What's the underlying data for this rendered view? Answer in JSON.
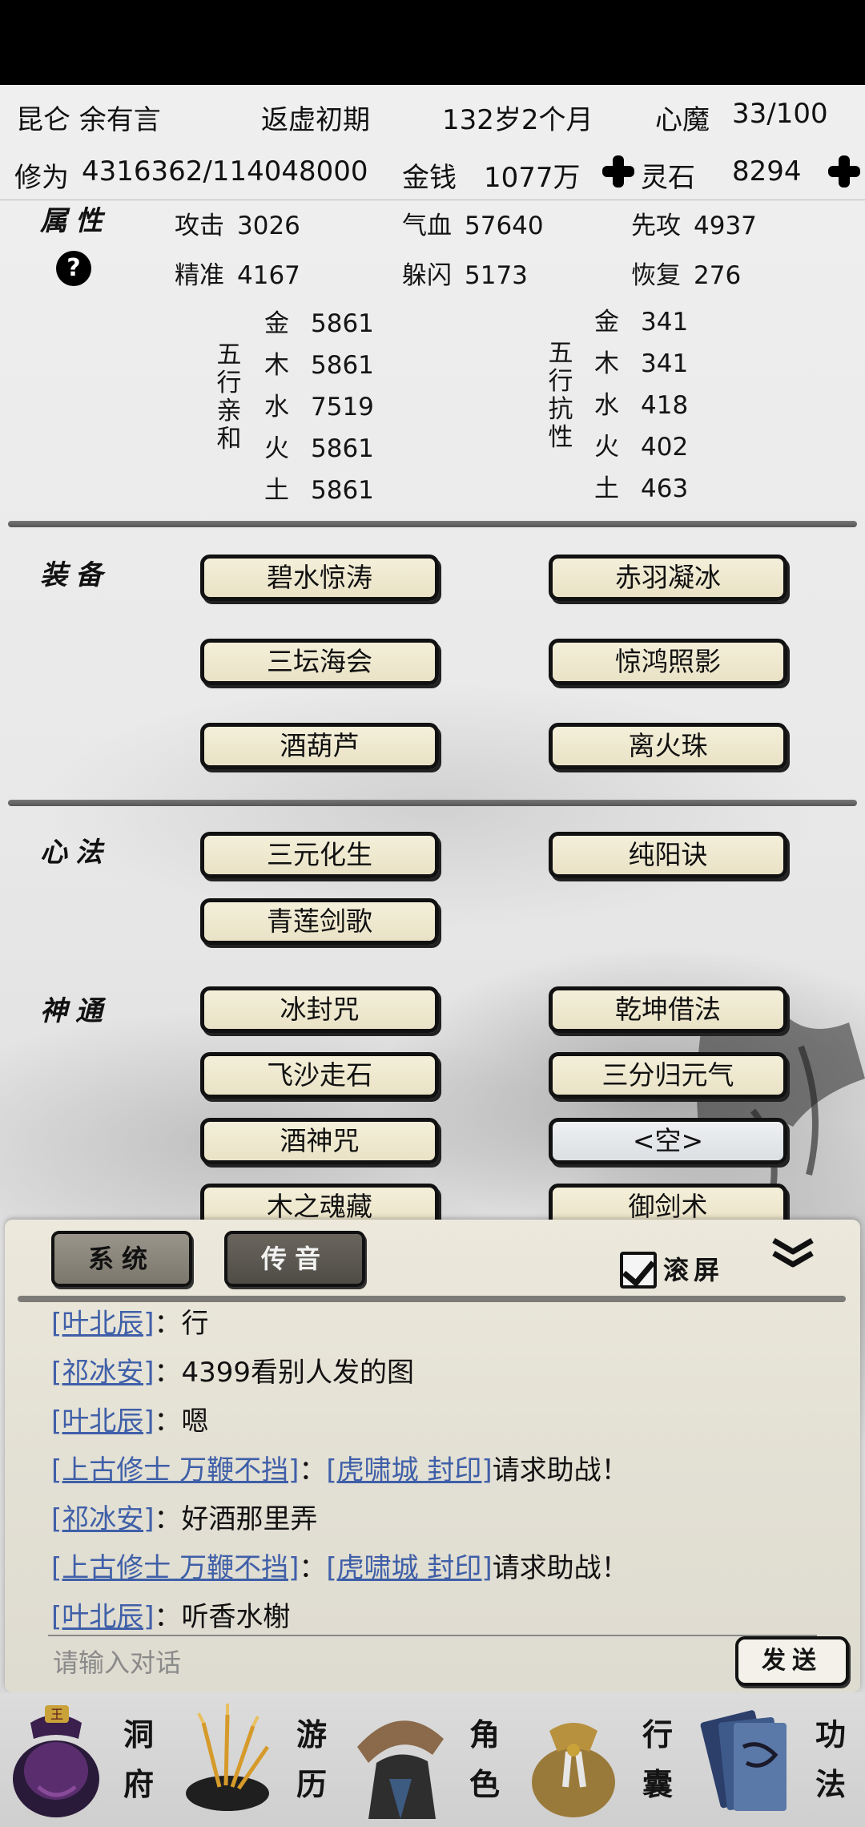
{
  "header": {
    "sect_name": "昆仑 余有言",
    "realm": "返虚初期",
    "age": "132岁2个月",
    "heart_demon_label": "心魔",
    "heart_demon_value": "33/100",
    "cultivation_label": "修为",
    "cultivation_value": "4316362/114048000",
    "money_label": "金钱",
    "money_value": "1077万",
    "spirit_stone_label": "灵石",
    "spirit_stone_value": "8294"
  },
  "attributes": {
    "title": "属性",
    "help": "?",
    "attack_label": "攻击",
    "attack_value": "3026",
    "hp_label": "气血",
    "hp_value": "57640",
    "initiative_label": "先攻",
    "initiative_value": "4937",
    "accuracy_label": "精准",
    "accuracy_value": "4167",
    "dodge_label": "躲闪",
    "dodge_value": "5173",
    "recovery_label": "恢复",
    "recovery_value": "276",
    "affinity_title": [
      "五",
      "行",
      "亲",
      "和"
    ],
    "resist_title": [
      "五",
      "行",
      "抗",
      "性"
    ],
    "affinity": [
      {
        "label": "金",
        "value": "5861"
      },
      {
        "label": "木",
        "value": "5861"
      },
      {
        "label": "水",
        "value": "7519"
      },
      {
        "label": "火",
        "value": "5861"
      },
      {
        "label": "土",
        "value": "5861"
      }
    ],
    "resistance": [
      {
        "label": "金",
        "value": "341"
      },
      {
        "label": "木",
        "value": "341"
      },
      {
        "label": "水",
        "value": "418"
      },
      {
        "label": "火",
        "value": "402"
      },
      {
        "label": "土",
        "value": "463"
      }
    ]
  },
  "equipment": {
    "title": "装备",
    "items": [
      "碧水惊涛",
      "赤羽凝冰",
      "三坛海会",
      "惊鸿照影",
      "酒葫芦",
      "离火珠"
    ]
  },
  "mental_methods": {
    "title": "心法",
    "items": [
      "三元化生",
      "纯阳诀",
      "青莲剑歌"
    ]
  },
  "divine_arts": {
    "title": "神通",
    "items": [
      "冰封咒",
      "乾坤借法",
      "飞沙走石",
      "三分归元气",
      "酒神咒",
      "<空>",
      "木之魂藏",
      "御剑术"
    ]
  },
  "chat": {
    "tab_system": "系统",
    "tab_whisper": "传音",
    "scroll_label": "滚屏",
    "messages": [
      {
        "name": "[叶北辰]",
        "sep": "：",
        "link2": "",
        "text": "行"
      },
      {
        "name": "[祁冰安]",
        "sep": "：",
        "link2": "",
        "text": "4399看别人发的图"
      },
      {
        "name": "[叶北辰]",
        "sep": "：",
        "link2": "",
        "text": "嗯"
      },
      {
        "name": "[上古修士 万鞭不挡]",
        "sep": "：",
        "link2": "[虎啸城 封印]",
        "text": "请求助战！"
      },
      {
        "name": "[祁冰安]",
        "sep": "：",
        "link2": "",
        "text": "好酒那里弄"
      },
      {
        "name": "[上古修士 万鞭不挡]",
        "sep": "：",
        "link2": "[虎啸城 封印]",
        "text": "请求助战！"
      },
      {
        "name": "[叶北辰]",
        "sep": "：",
        "link2": "",
        "text": "听香水榭"
      }
    ],
    "input_placeholder": "请输入对话",
    "send_label": "发送"
  },
  "nav": [
    {
      "icon": "cave-mansion-icon",
      "label": [
        "洞",
        "府"
      ]
    },
    {
      "icon": "travel-icon",
      "label": [
        "游",
        "历"
      ]
    },
    {
      "icon": "character-icon",
      "label": [
        "角",
        "色"
      ]
    },
    {
      "icon": "bag-icon",
      "label": [
        "行",
        "囊"
      ]
    },
    {
      "icon": "technique-book-icon",
      "label": [
        "功",
        "法"
      ]
    }
  ]
}
